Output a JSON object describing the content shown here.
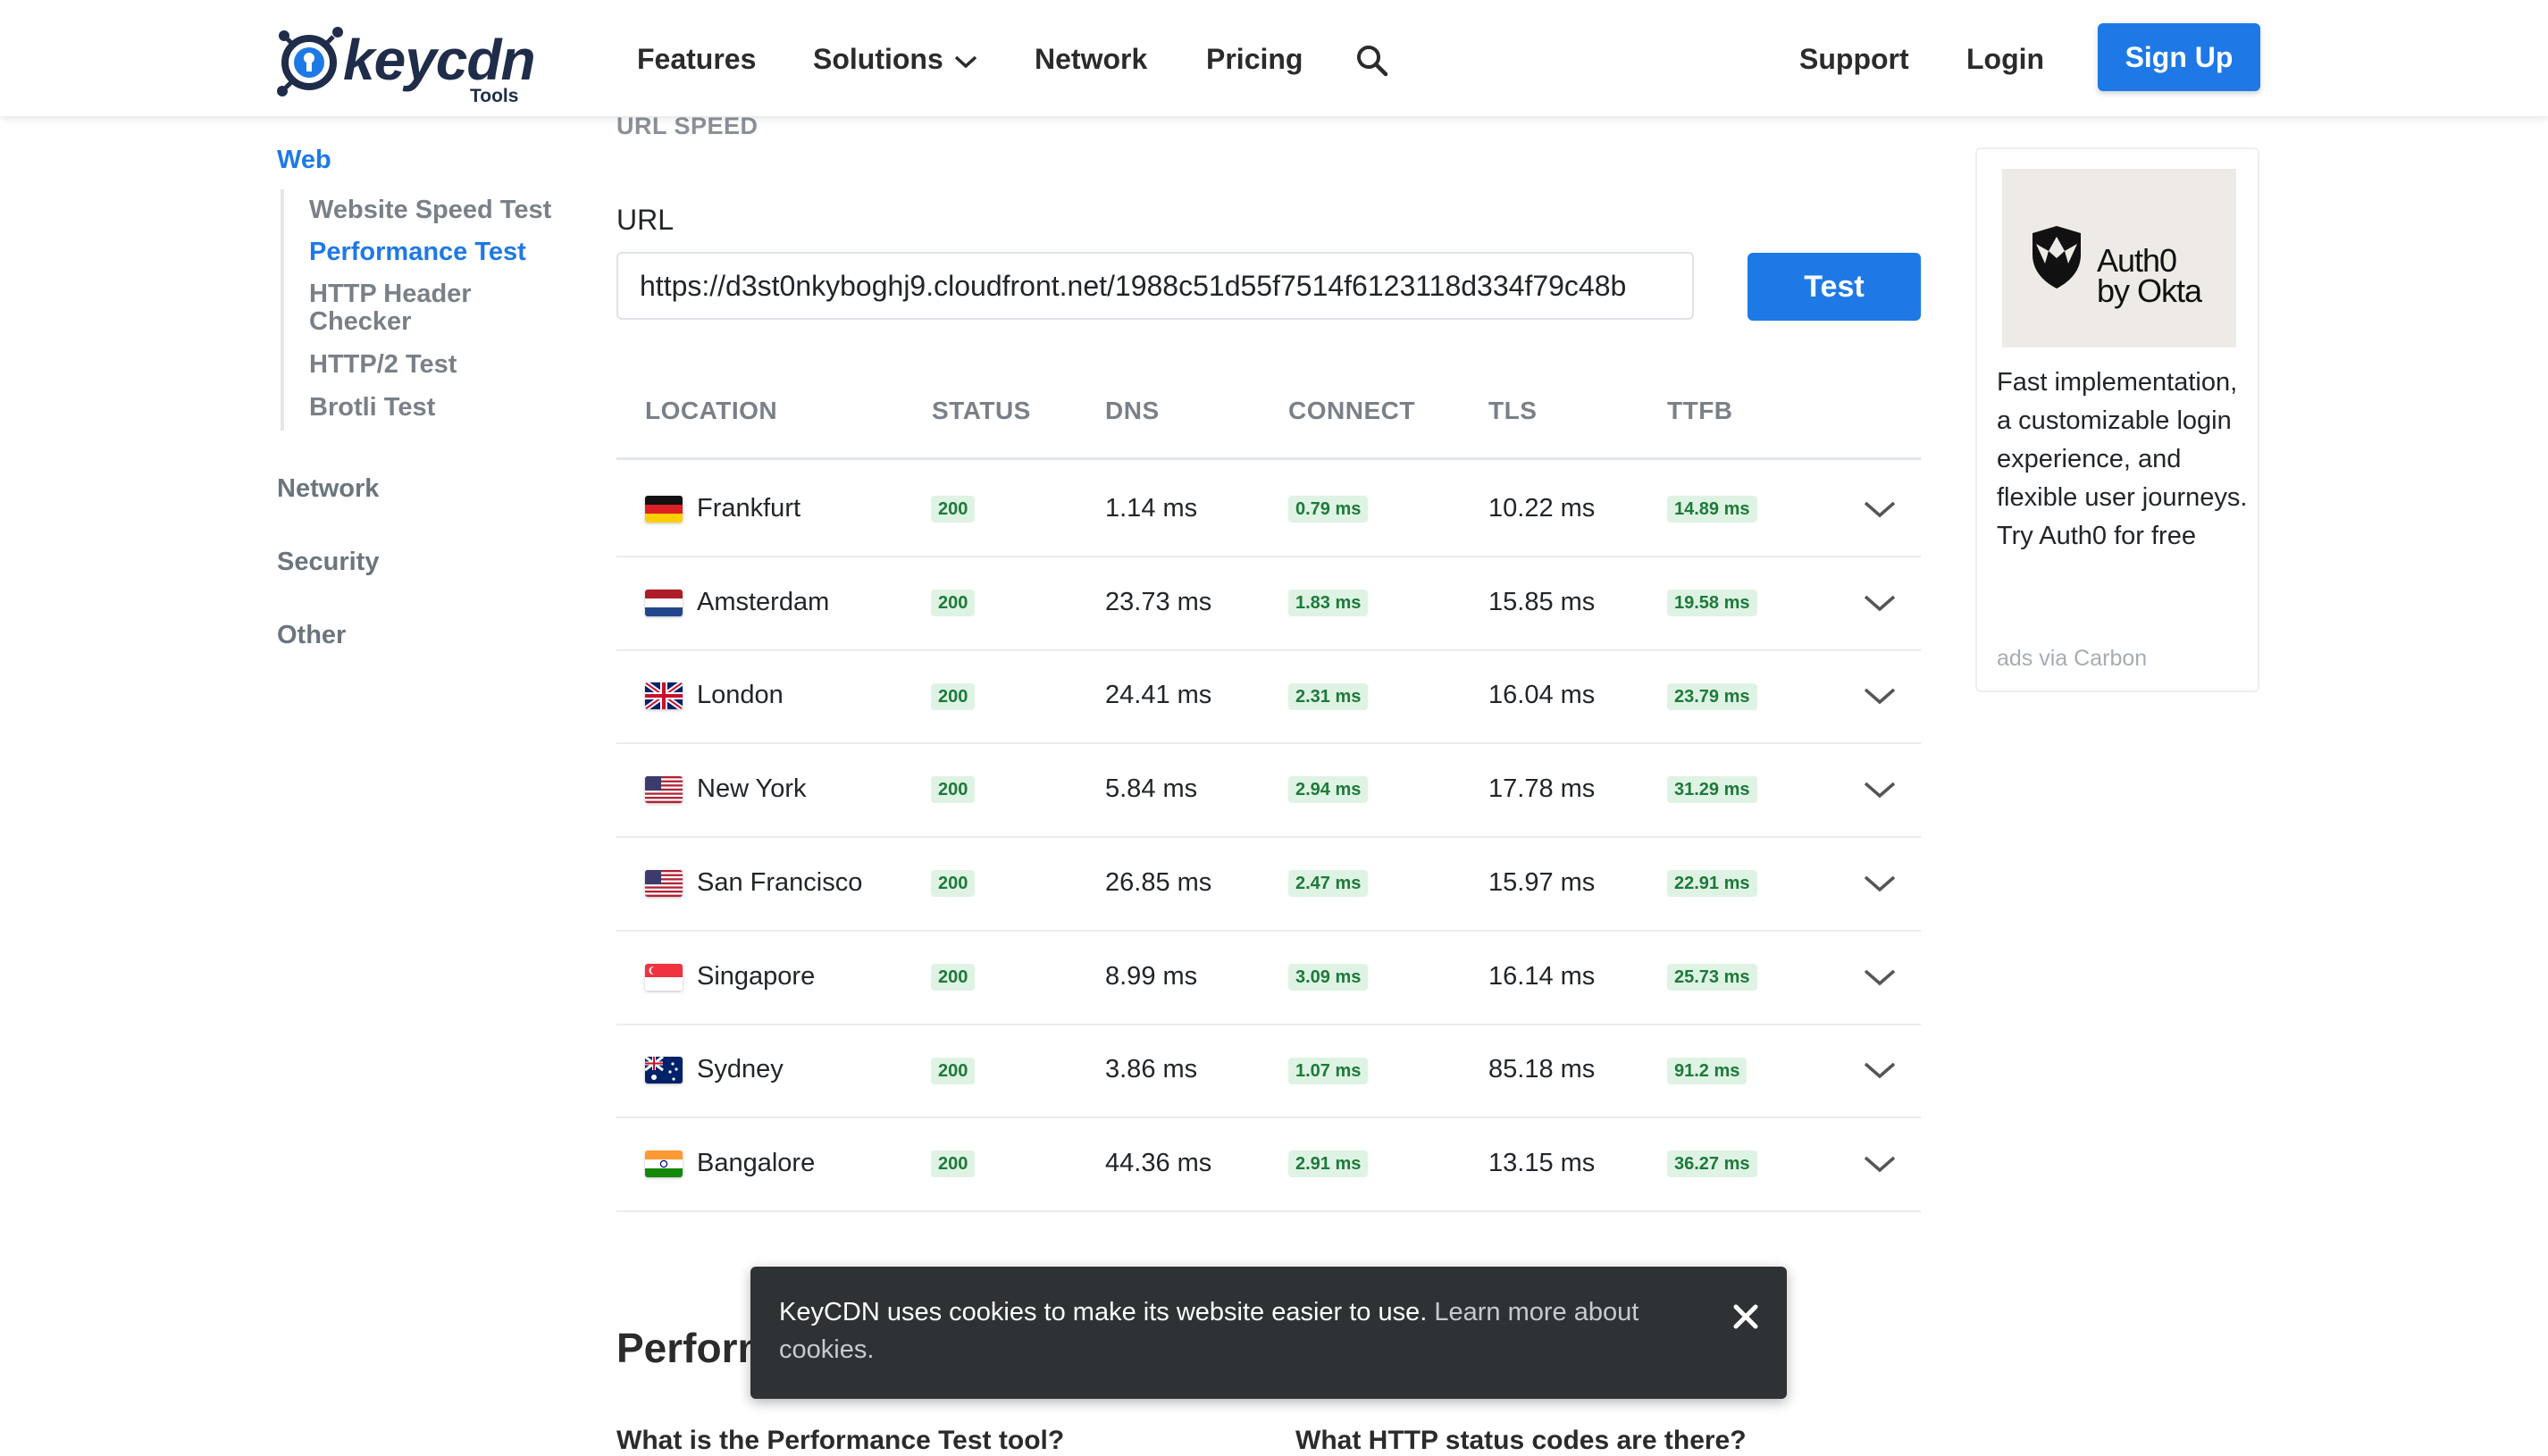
{
  "header": {
    "logo_text": "keycdn",
    "logo_sub": "Tools",
    "nav": [
      "Features",
      "Solutions",
      "Network",
      "Pricing"
    ],
    "support": "Support",
    "login": "Login",
    "signup": "Sign Up"
  },
  "sidebar": {
    "web": "Web",
    "web_links": [
      "Website Speed Test",
      "Performance Test",
      "HTTP Header Checker",
      "HTTP/2 Test",
      "Brotli Test"
    ],
    "active_link": "Performance Test",
    "network": "Network",
    "security": "Security",
    "other": "Other"
  },
  "main": {
    "section_title": "URL SPEED",
    "url_label": "URL",
    "url_value": "https://d3st0nkyboghj9.cloudfront.net/1988c51d55f7514f6123118d334f79c48b",
    "test_button": "Test",
    "columns": [
      "LOCATION",
      "STATUS",
      "DNS",
      "CONNECT",
      "TLS",
      "TTFB"
    ],
    "rows": [
      {
        "location": "Frankfurt",
        "flag": "de",
        "status": "200",
        "dns": "1.14 ms",
        "connect": "0.79 ms",
        "tls": "10.22 ms",
        "ttfb": "14.89 ms"
      },
      {
        "location": "Amsterdam",
        "flag": "nl",
        "status": "200",
        "dns": "23.73 ms",
        "connect": "1.83 ms",
        "tls": "15.85 ms",
        "ttfb": "19.58 ms"
      },
      {
        "location": "London",
        "flag": "gb",
        "status": "200",
        "dns": "24.41 ms",
        "connect": "2.31 ms",
        "tls": "16.04 ms",
        "ttfb": "23.79 ms"
      },
      {
        "location": "New York",
        "flag": "us",
        "status": "200",
        "dns": "5.84 ms",
        "connect": "2.94 ms",
        "tls": "17.78 ms",
        "ttfb": "31.29 ms"
      },
      {
        "location": "San Francisco",
        "flag": "us",
        "status": "200",
        "dns": "26.85 ms",
        "connect": "2.47 ms",
        "tls": "15.97 ms",
        "ttfb": "22.91 ms"
      },
      {
        "location": "Singapore",
        "flag": "sg",
        "status": "200",
        "dns": "8.99 ms",
        "connect": "3.09 ms",
        "tls": "16.14 ms",
        "ttfb": "25.73 ms"
      },
      {
        "location": "Sydney",
        "flag": "au",
        "status": "200",
        "dns": "3.86 ms",
        "connect": "1.07 ms",
        "tls": "85.18 ms",
        "ttfb": "91.2 ms"
      },
      {
        "location": "Bangalore",
        "flag": "in",
        "status": "200",
        "dns": "44.36 ms",
        "connect": "2.91 ms",
        "tls": "13.15 ms",
        "ttfb": "36.27 ms"
      }
    ],
    "perf_heading": "Performance Test",
    "faq_1": "What is the Performance Test tool?",
    "faq_2": "What HTTP status codes are there?"
  },
  "ad": {
    "brand_line1": "Auth0",
    "brand_line2": "by Okta",
    "text": "Fast implementation, a customizable login experience, and flexible user journeys. Try Auth0 for free",
    "via": "ads via Carbon"
  },
  "cookie": {
    "text": "KeyCDN uses cookies to make its website easier to use.",
    "link": "Learn more about cookies."
  },
  "colors": {
    "accent": "#1e79e6",
    "badge_bg": "#dff3e4",
    "badge_text": "#1d7a3a",
    "banner_bg": "#2f3234"
  },
  "icons": [
    "search-icon",
    "chevron-down-icon",
    "close-icon",
    "flag-icon"
  ]
}
